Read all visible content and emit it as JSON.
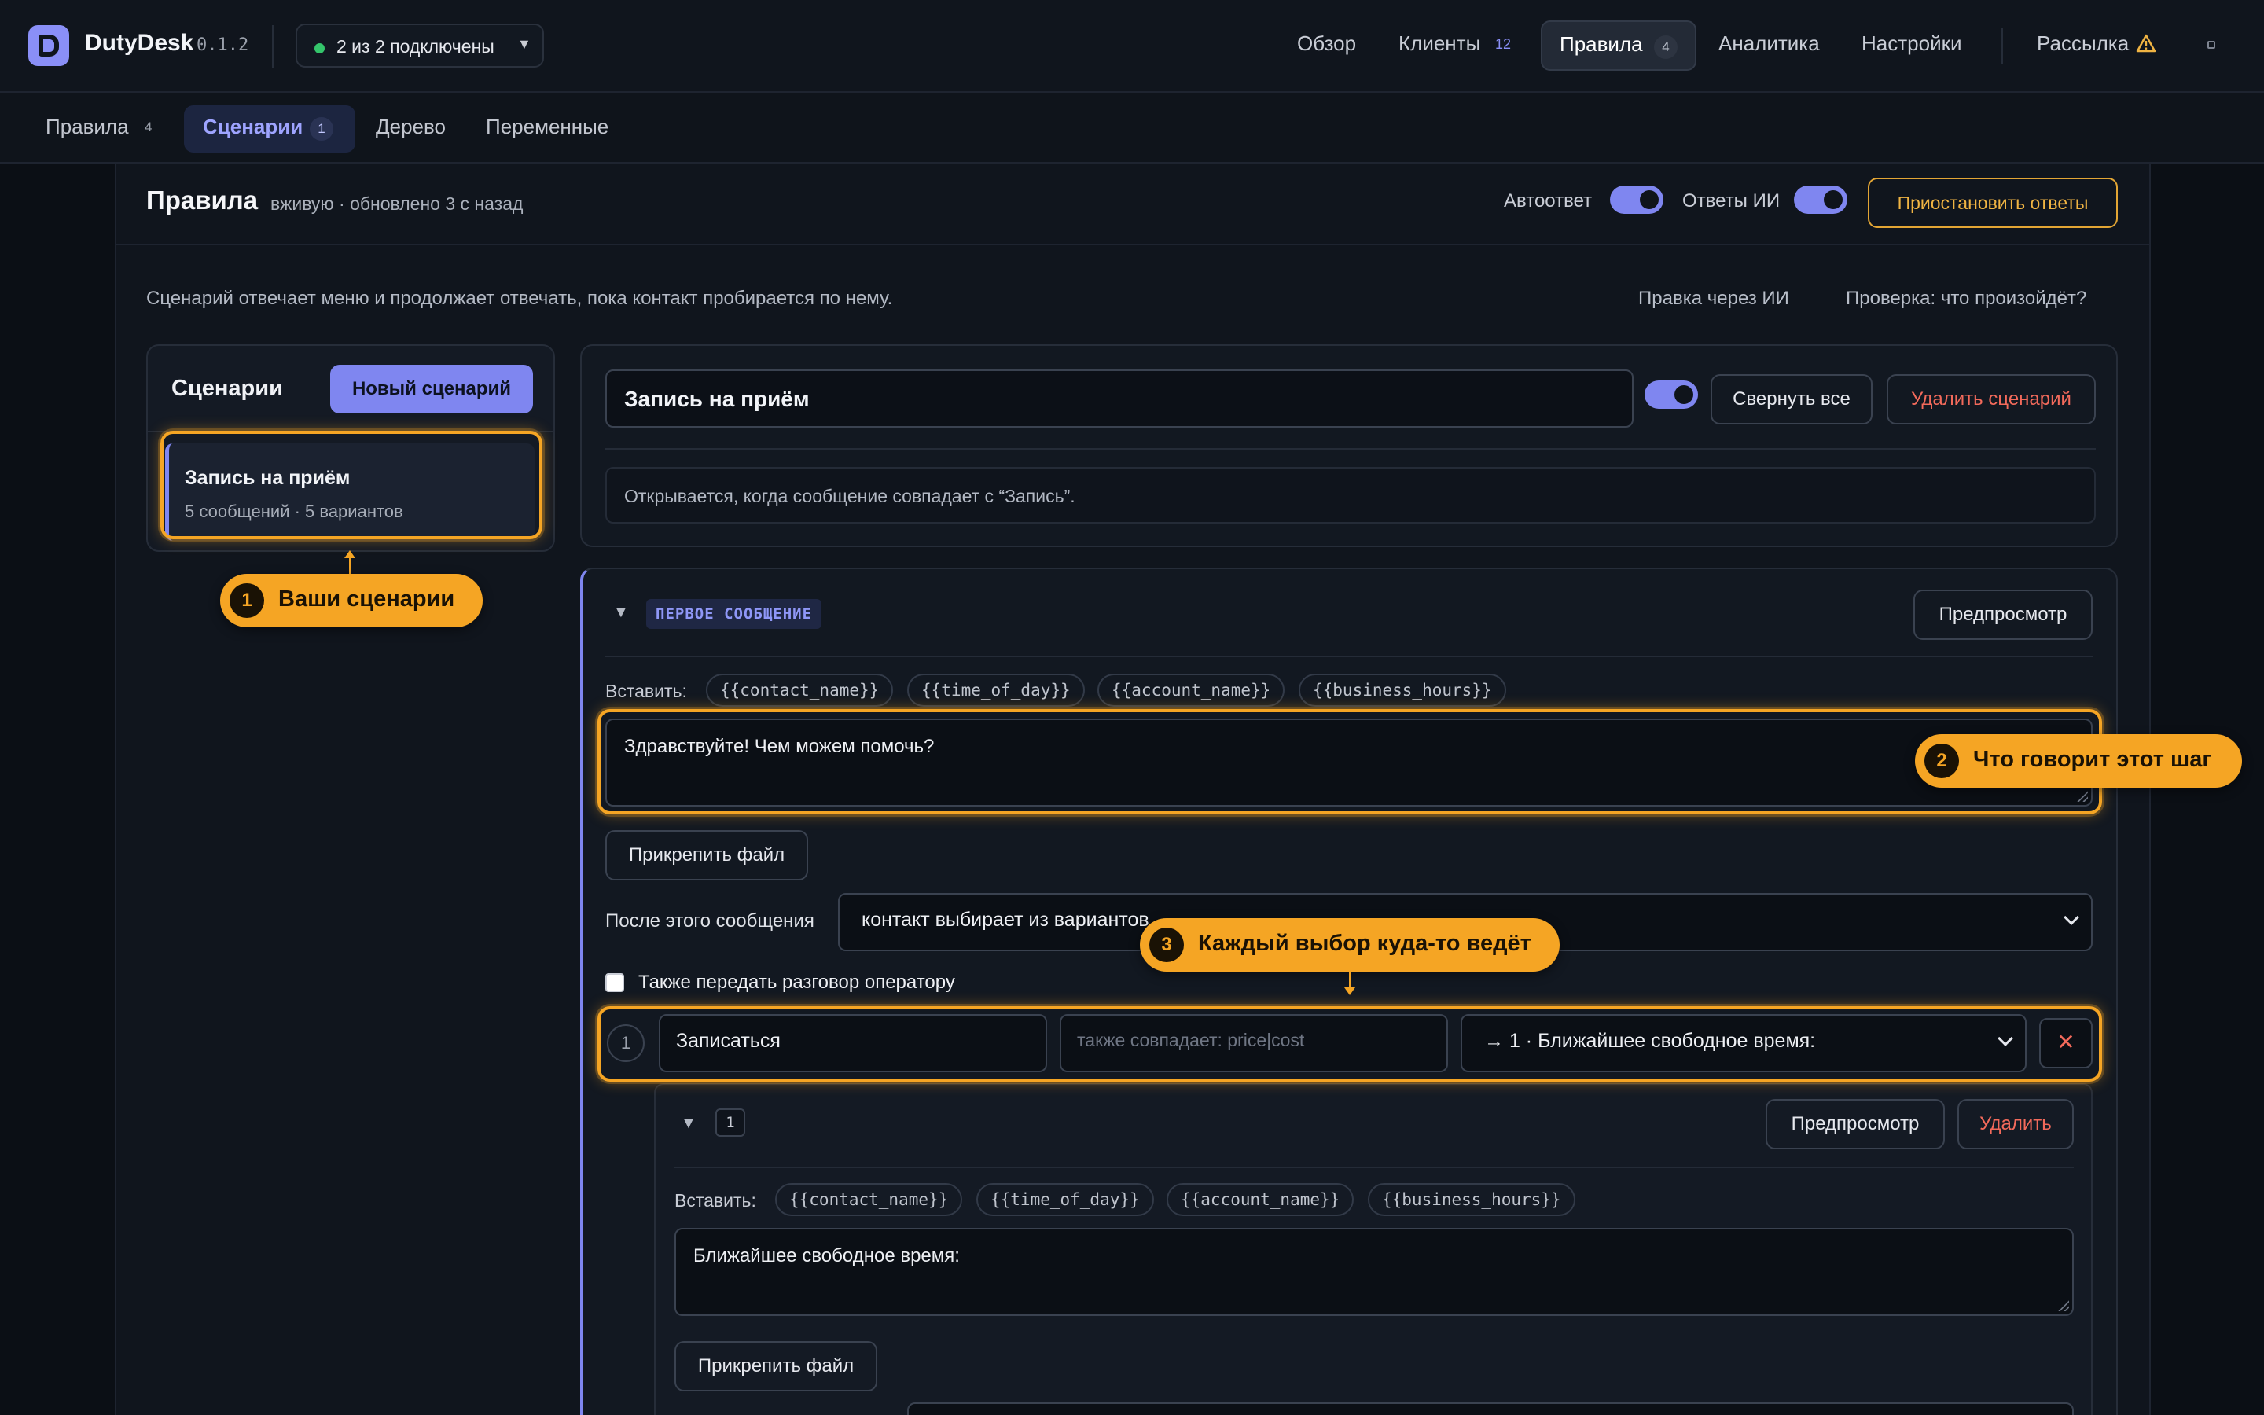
{
  "app": {
    "brand": "DutyDesk",
    "version": "0.1.2",
    "connection": "2 из 2 подключены"
  },
  "nav": {
    "overview": "Обзор",
    "clients": "Клиенты",
    "clients_count": "12",
    "rules": "Правила",
    "rules_count": "4",
    "analytics": "Аналитика",
    "settings": "Настройки",
    "broadcast": "Рассылка"
  },
  "subtabs": {
    "rules": "Правила",
    "rules_count": "4",
    "scenarios": "Сценарии",
    "scenarios_count": "1",
    "tree": "Дерево",
    "variables": "Переменные"
  },
  "header": {
    "title": "Правила",
    "meta": "вживую · обновлено 3 с назад",
    "autoreply_label": "Автоответ",
    "ai_replies_label": "Ответы ИИ",
    "pause_button": "Приостановить ответы",
    "autoreply_on": true,
    "ai_replies_on": true
  },
  "intro": {
    "description": "Сценарий отвечает меню и продолжает отвечать, пока контакт пробирается по нему.",
    "ai_edit": "Правка через ИИ",
    "check": "Проверка: что произойдёт?"
  },
  "scenarios_list": {
    "title": "Сценарии",
    "new_button": "Новый сценарий",
    "items": [
      {
        "name": "Запись на приём",
        "summary": "5 сообщений · 5 вариантов"
      }
    ]
  },
  "editor": {
    "name": "Запись на приём",
    "enabled": true,
    "collapse_all": "Свернуть все",
    "delete_scenario": "Удалить сценарий",
    "trigger": "Открывается, когда сообщение совпадает с “Запись”."
  },
  "first_message": {
    "tag": "ПЕРВОЕ СООБЩЕНИЕ",
    "preview": "Предпросмотр",
    "insert_label": "Вставить:",
    "variables": [
      "{{contact_name}}",
      "{{time_of_day}}",
      "{{account_name}}",
      "{{business_hours}}"
    ],
    "text": "Здравствуйте! Чем можем помочь?",
    "attach": "Прикрепить файл",
    "after_label": "После этого сообщения",
    "after_value": "контакт выбирает из вариантов",
    "handoff_label": "Также передать разговор оператору",
    "handoff_checked": false,
    "option": {
      "index": "1",
      "label": "Записаться",
      "also_matches_placeholder": "также совпадает: price|cost",
      "target": "→ 1 · Ближайшее свободное время:",
      "remove": "✕"
    }
  },
  "step": {
    "number": "1",
    "preview": "Предпросмотр",
    "delete": "Удалить",
    "insert_label": "Вставить:",
    "variables": [
      "{{contact_name}}",
      "{{time_of_day}}",
      "{{account_name}}",
      "{{business_hours}}"
    ],
    "text": "Ближайшее свободное время:",
    "attach": "Прикрепить файл"
  },
  "callouts": [
    {
      "num": "1",
      "text": "Ваши сценарии"
    },
    {
      "num": "2",
      "text": "Что говорит этот шаг"
    },
    {
      "num": "3",
      "text": "Каждый выбор куда-то ведёт"
    }
  ],
  "colors": {
    "accent": "#7f86f0",
    "highlight": "#f5a524",
    "danger": "#f36a5b",
    "warning": "#e2a534",
    "status_ok": "#34c56b"
  }
}
